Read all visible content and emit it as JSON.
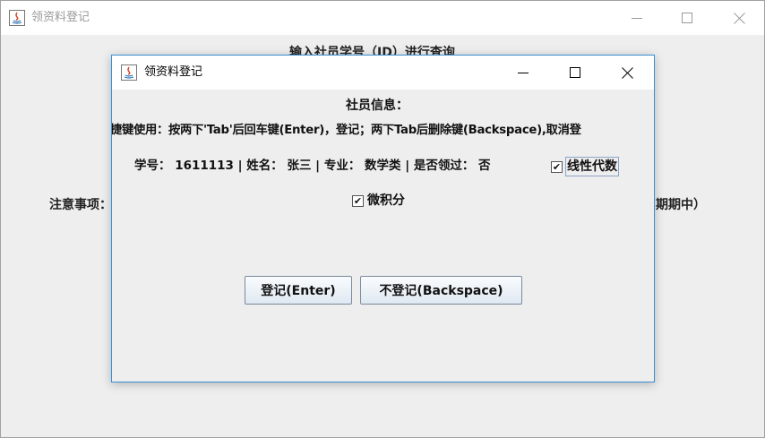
{
  "main_window": {
    "title": "领资料登记",
    "query_heading": "输入社员学号（ID）进行查询",
    "notice_label": "注意事项：",
    "notice_tail": "期期中）"
  },
  "dialog": {
    "title": "领资料登记",
    "member_info_heading": "社员信息：",
    "shortcut_hint": "捷键使用：按两下'Tab'后回车键(Enter)，登记；两下Tab后删除键(Backspace),取消登",
    "info_line": "学号：  1611113 | 姓名：  张三  | 专业：  数学类  | 是否领过：  否",
    "checkboxes": [
      {
        "label": "线性代数",
        "checked": true,
        "mark": "✔"
      },
      {
        "label": "微积分",
        "checked": true,
        "mark": "✔"
      }
    ],
    "buttons": {
      "register": "登记(Enter)",
      "cancel": "不登记(Backspace)"
    }
  },
  "window_controls": {
    "minimize": "minimize-icon",
    "maximize": "maximize-icon",
    "close": "close-icon"
  },
  "colors": {
    "dialog_border": "#3a8fd4",
    "window_bg": "#eeeeee",
    "button_border": "#7a8a9e"
  }
}
